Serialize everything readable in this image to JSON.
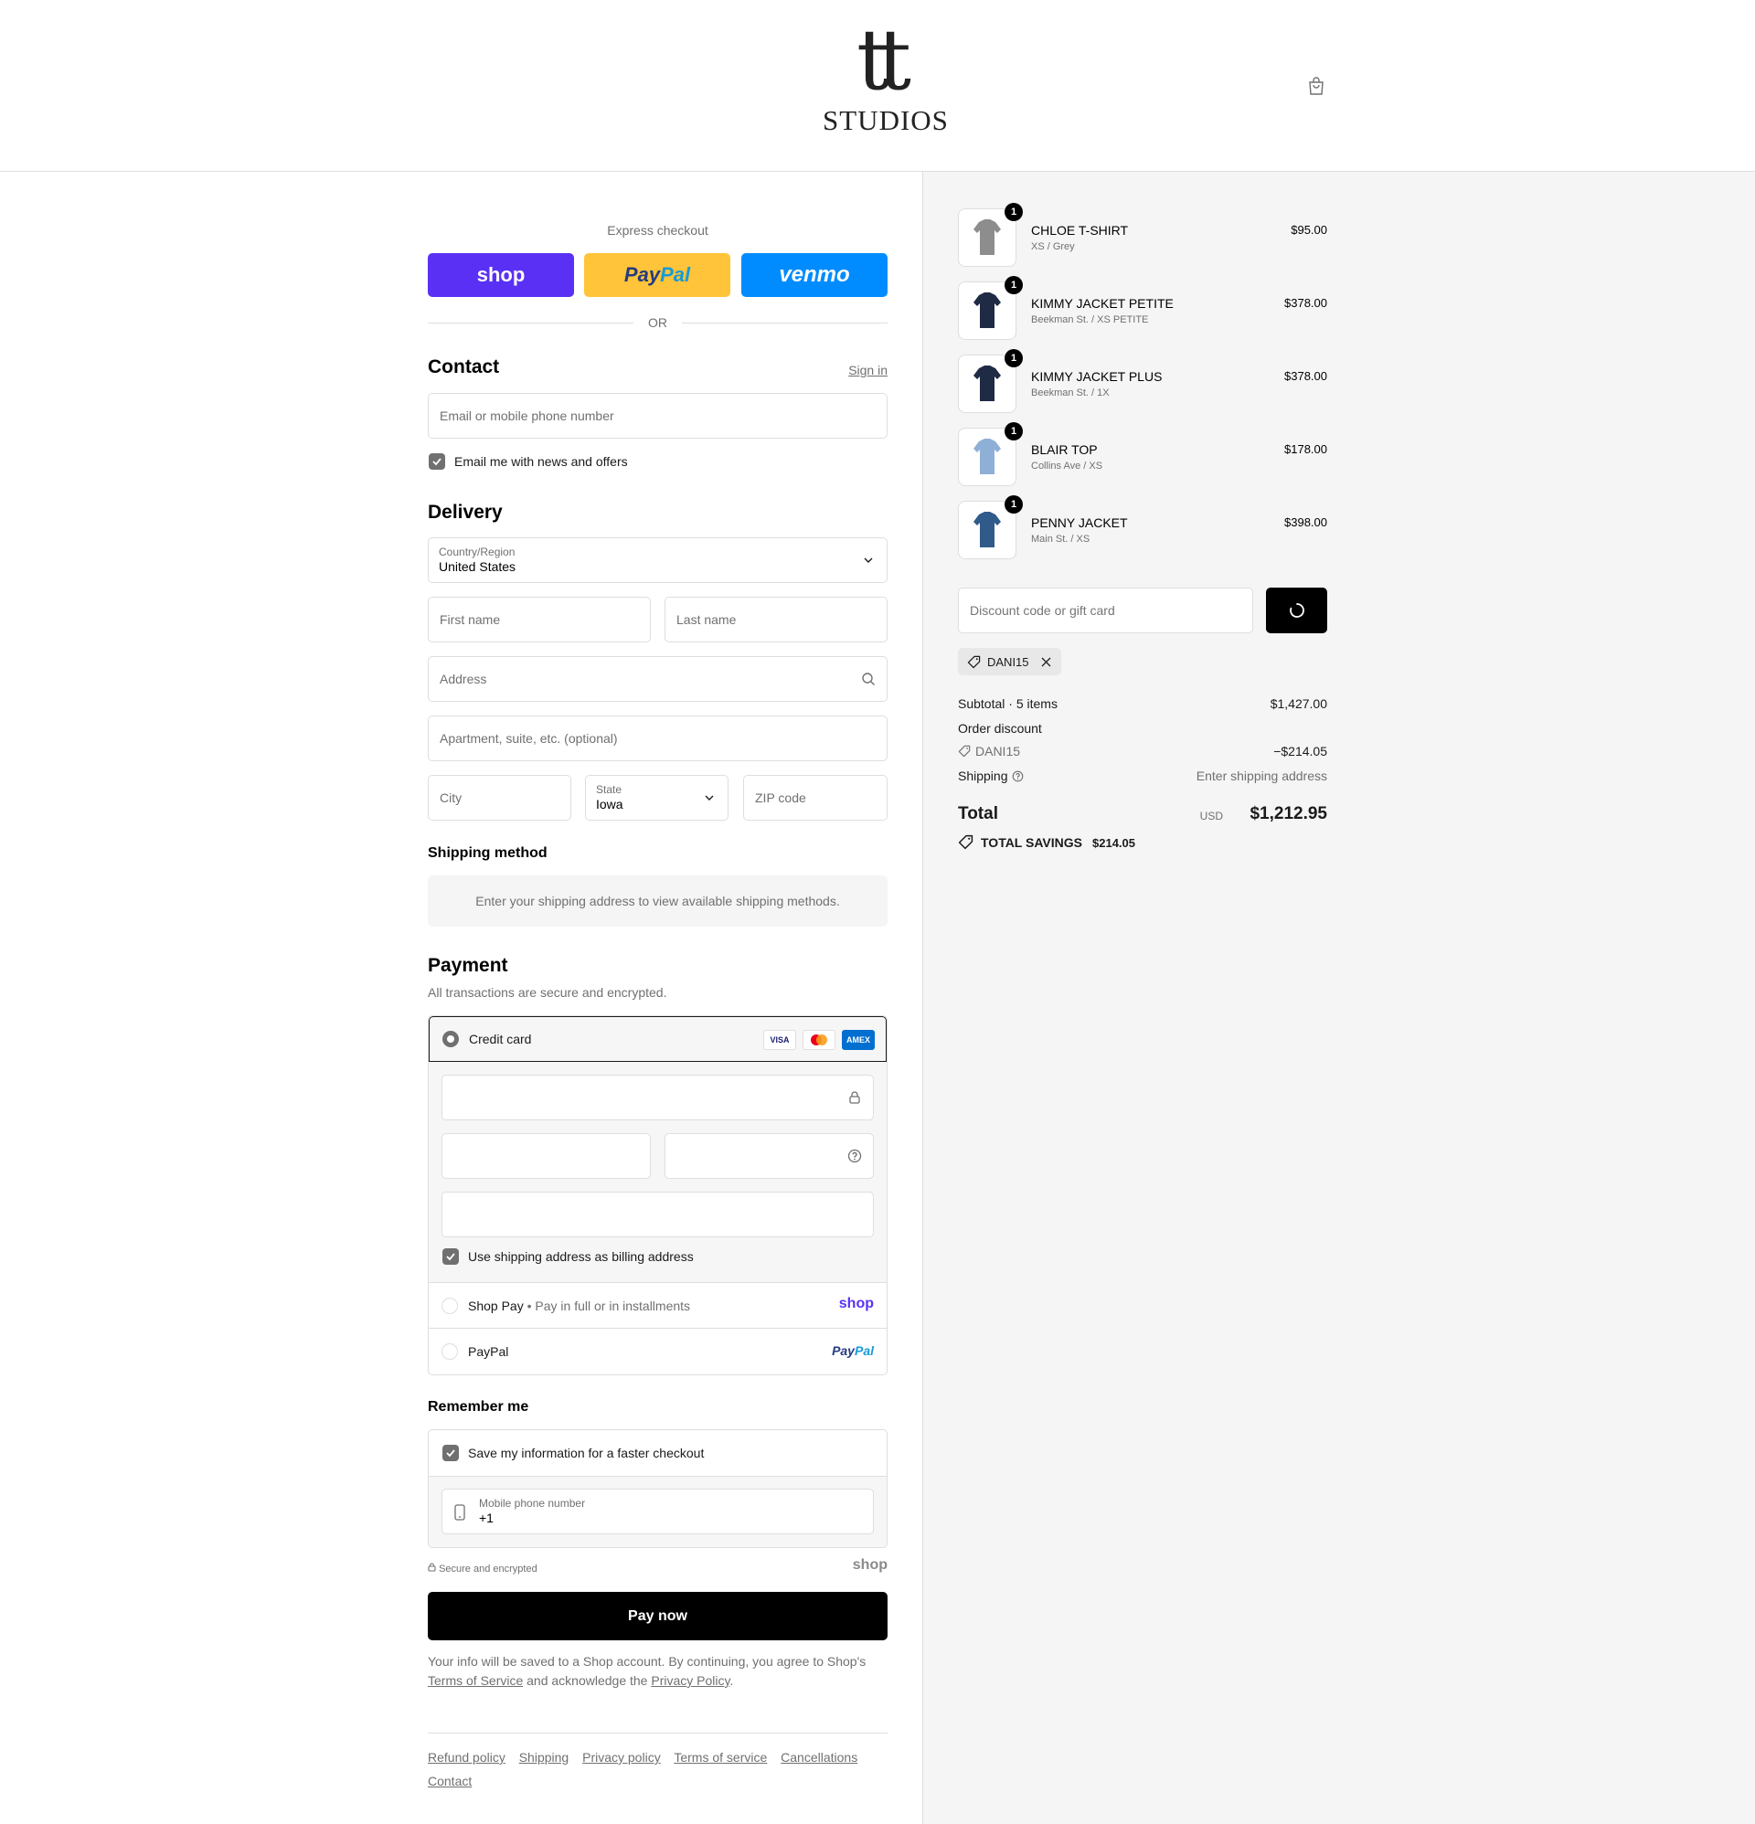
{
  "brand": {
    "logo_mark": "tt",
    "logo_word": "STUDIOS"
  },
  "header": {
    "cart_icon": "shopping-bag-icon"
  },
  "express": {
    "title": "Express checkout",
    "shop_label": "shop",
    "paypal_label_a": "Pay",
    "paypal_label_b": "Pal",
    "venmo_label": "venmo",
    "or_label": "OR"
  },
  "contact": {
    "title": "Contact",
    "sign_in": "Sign in",
    "email_placeholder": "Email or mobile phone number",
    "news_label": "Email me with news and offers",
    "news_checked": true
  },
  "delivery": {
    "title": "Delivery",
    "country_label": "Country/Region",
    "country_value": "United States",
    "first_name_placeholder": "First name",
    "last_name_placeholder": "Last name",
    "address_placeholder": "Address",
    "apartment_placeholder": "Apartment, suite, etc. (optional)",
    "city_placeholder": "City",
    "state_label": "State",
    "state_value": "Iowa",
    "zip_placeholder": "ZIP code"
  },
  "shipping_method": {
    "title": "Shipping method",
    "info": "Enter your shipping address to view available shipping methods."
  },
  "payment": {
    "title": "Payment",
    "subtitle": "All transactions are secure and encrypted.",
    "credit_card_label": "Credit card",
    "cards": [
      "VISA",
      "MC",
      "AMEX"
    ],
    "billing_same_label": "Use shipping address as billing address",
    "shop_pay_label": "Shop Pay",
    "shop_pay_sub": "Pay in full or in installments",
    "shop_pay_logo": "shop",
    "paypal_label": "PayPal",
    "paypal_logo_a": "Pay",
    "paypal_logo_b": "Pal"
  },
  "remember": {
    "title": "Remember me",
    "save_label": "Save my information for a faster checkout",
    "phone_label": "Mobile phone number",
    "phone_value": "+1"
  },
  "secure_label": "Secure and encrypted",
  "shop_logo": "shop",
  "pay_now": "Pay now",
  "legal": {
    "text_a": "Your info will be saved to a Shop account. By continuing, you agree to Shop's",
    "terms": "Terms of Service",
    "text_b": "and acknowledge the",
    "privacy": "Privacy Policy",
    "text_c": "."
  },
  "footer_links": [
    "Refund policy",
    "Shipping",
    "Privacy policy",
    "Terms of service",
    "Cancellations",
    "Contact"
  ],
  "cart": {
    "items": [
      {
        "name": "CHLOE T-SHIRT",
        "variant": "XS / Grey",
        "price": "$95.00",
        "qty": "1",
        "color": "#8d8d8d"
      },
      {
        "name": "KIMMY JACKET PETITE",
        "variant": "Beekman St. / XS PETITE",
        "price": "$378.00",
        "qty": "1",
        "color": "#1f2a44"
      },
      {
        "name": "KIMMY JACKET PLUS",
        "variant": "Beekman St. / 1X",
        "price": "$378.00",
        "qty": "1",
        "color": "#1f2a44"
      },
      {
        "name": "BLAIR TOP",
        "variant": "Collins Ave / XS",
        "price": "$178.00",
        "qty": "1",
        "color": "#8fb0d6"
      },
      {
        "name": "PENNY JACKET",
        "variant": "Main St. / XS",
        "price": "$398.00",
        "qty": "1",
        "color": "#2f5a8a"
      }
    ],
    "discount_placeholder": "Discount code or gift card",
    "applied_code": "DANI15",
    "subtotal_label": "Subtotal · 5 items",
    "subtotal_value": "$1,427.00",
    "order_discount_label": "Order discount",
    "discount_code": "DANI15",
    "discount_value": "−$214.05",
    "shipping_label": "Shipping",
    "shipping_value": "Enter shipping address",
    "total_label": "Total",
    "currency": "USD",
    "total_value": "$1,212.95",
    "savings_label": "TOTAL SAVINGS",
    "savings_value": "$214.05"
  }
}
